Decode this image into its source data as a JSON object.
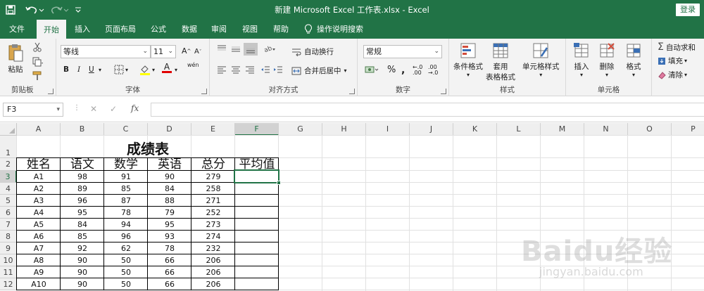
{
  "titlebar": {
    "title": "新建 Microsoft Excel 工作表.xlsx  -  Excel",
    "login_label": "登录",
    "icons": [
      "save-icon",
      "undo-icon",
      "redo-icon",
      "customize-icon"
    ]
  },
  "tabs": [
    {
      "label": "文件"
    },
    {
      "label": "开始",
      "active": true
    },
    {
      "label": "插入"
    },
    {
      "label": "页面布局"
    },
    {
      "label": "公式"
    },
    {
      "label": "数据"
    },
    {
      "label": "审阅"
    },
    {
      "label": "视图"
    },
    {
      "label": "帮助"
    },
    {
      "label": "操作说明搜索"
    }
  ],
  "ribbon": {
    "clipboard": {
      "label": "剪贴板",
      "paste": "粘贴"
    },
    "font": {
      "label": "字体",
      "name": "等线",
      "size": "11"
    },
    "alignment": {
      "label": "对齐方式",
      "wrap": "自动换行",
      "merge": "合并后居中"
    },
    "number": {
      "label": "数字",
      "format": "常规"
    },
    "styles": {
      "label": "样式",
      "conditional": "条件格式",
      "table_1": "套用",
      "table_2": "表格格式",
      "cell_styles": "单元格样式"
    },
    "cells": {
      "label": "单元格",
      "insert": "插入",
      "delete": "删除",
      "format": "格式"
    },
    "editing": {
      "autosum": "自动求和",
      "fill": "填充",
      "clear": "清除"
    }
  },
  "formula_bar": {
    "name_box": "F3",
    "fx": "fx",
    "value": ""
  },
  "sheet": {
    "columns": [
      "A",
      "B",
      "C",
      "D",
      "E",
      "F",
      "G",
      "H",
      "I",
      "J",
      "K",
      "L",
      "M",
      "N",
      "O",
      "P"
    ],
    "rows": [
      "1",
      "2",
      "3",
      "4",
      "5",
      "6",
      "7",
      "8",
      "9",
      "10",
      "11",
      "12"
    ],
    "selected_cell": "F3",
    "table_title": "成绩表",
    "headers": [
      "姓名",
      "语文",
      "数学",
      "英语",
      "总分",
      "平均值"
    ],
    "data": [
      [
        "A1",
        "98",
        "91",
        "90",
        "279",
        ""
      ],
      [
        "A2",
        "89",
        "85",
        "84",
        "258",
        ""
      ],
      [
        "A3",
        "96",
        "87",
        "88",
        "271",
        ""
      ],
      [
        "A4",
        "95",
        "78",
        "79",
        "252",
        ""
      ],
      [
        "A5",
        "84",
        "94",
        "95",
        "273",
        ""
      ],
      [
        "A6",
        "85",
        "96",
        "93",
        "274",
        ""
      ],
      [
        "A7",
        "92",
        "62",
        "78",
        "232",
        ""
      ],
      [
        "A8",
        "90",
        "50",
        "66",
        "206",
        ""
      ],
      [
        "A9",
        "90",
        "50",
        "66",
        "206",
        ""
      ],
      [
        "A10",
        "90",
        "50",
        "66",
        "206",
        ""
      ]
    ]
  },
  "watermark": {
    "brand": "Baidu经验",
    "url": "jingyan.baidu.com"
  },
  "colors": {
    "accent": "#217346",
    "ribbon_bg": "#f3f3f3",
    "header_bg": "#efefef"
  }
}
